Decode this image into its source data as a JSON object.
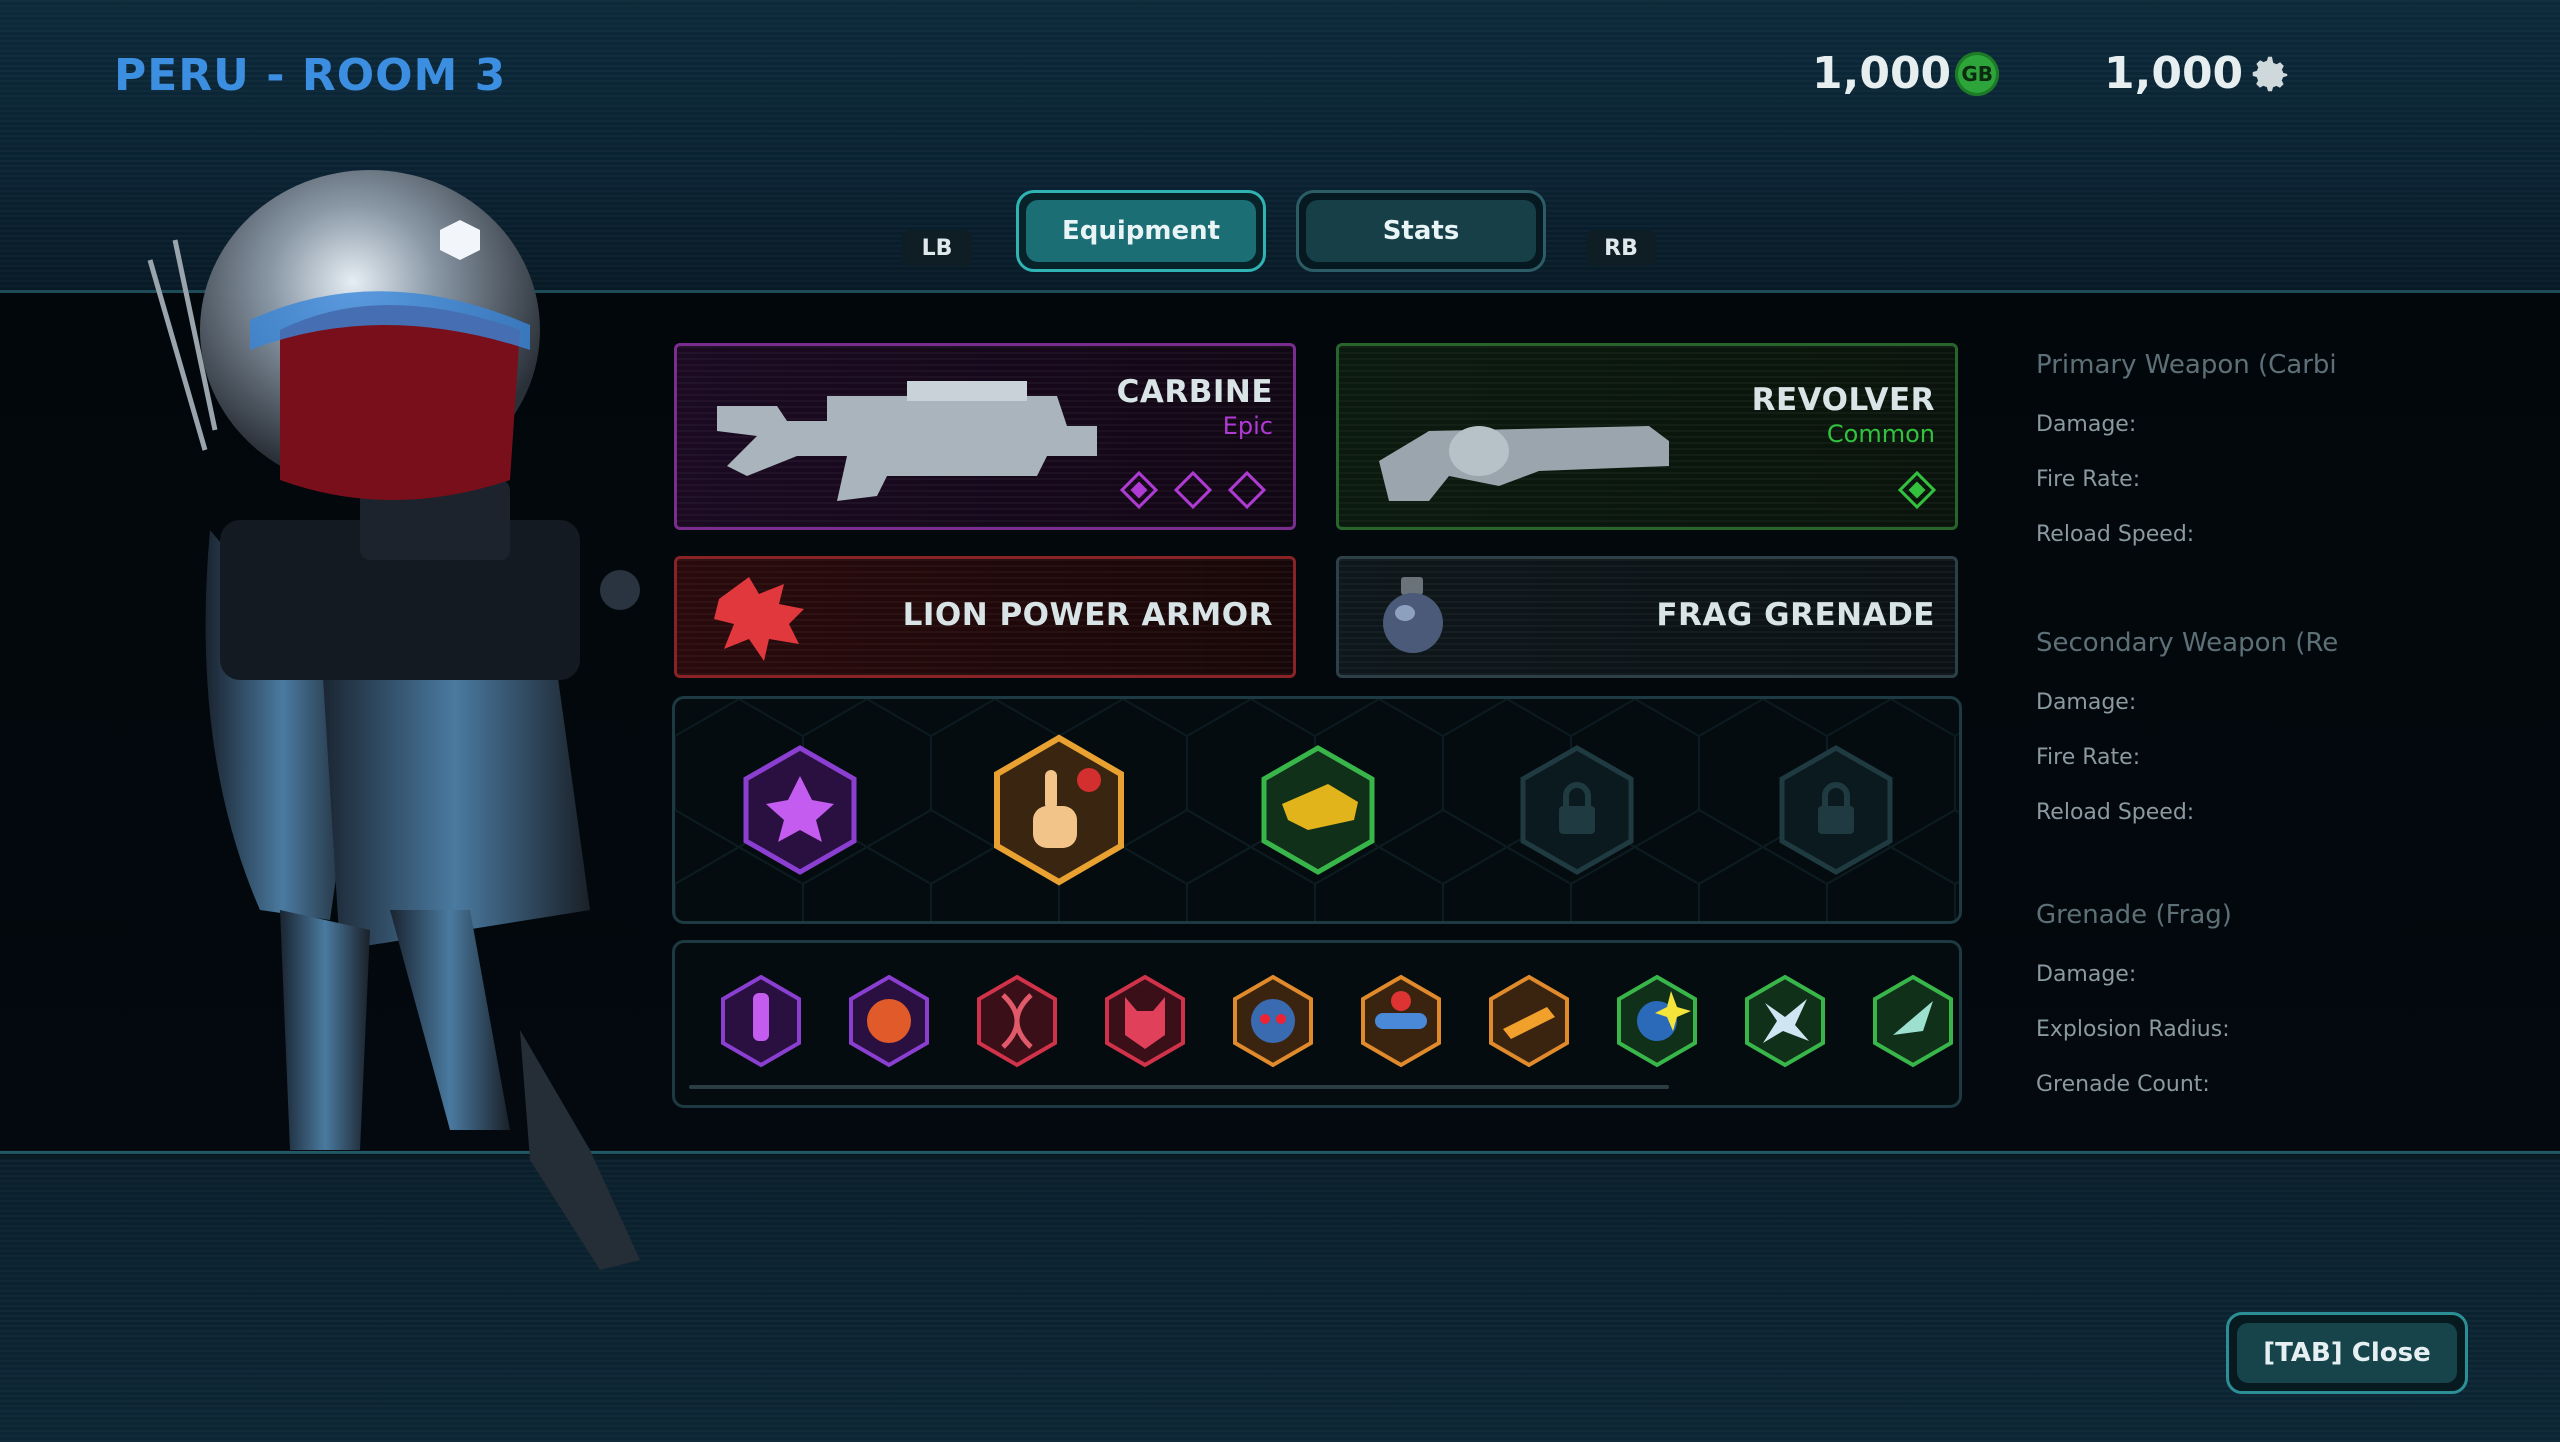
{
  "header": {
    "title": "PERU - ROOM 3",
    "currency_gb": "1,000",
    "currency_gb_icon_label": "GB",
    "currency_gear": "1,000"
  },
  "tabs": {
    "left_bumper": "LB",
    "right_bumper": "RB",
    "items": [
      {
        "label": "Equipment",
        "active": true
      },
      {
        "label": "Stats",
        "active": false
      }
    ]
  },
  "equipment": {
    "primary": {
      "name": "CARBINE",
      "rarity": "Epic",
      "rarity_color": "#b03ad4",
      "slots_filled": 1,
      "slots_total": 3
    },
    "secondary": {
      "name": "REVOLVER",
      "rarity": "Common",
      "rarity_color": "#32c23e",
      "slots_filled": 1,
      "slots_total": 1
    },
    "armor": {
      "name": "LION POWER ARMOR",
      "icon": "lion-head-icon"
    },
    "grenade": {
      "name": "FRAG GRENADE",
      "icon": "grenade-icon"
    }
  },
  "abilities": [
    {
      "icon": "purple-explosion-icon",
      "border": "#8b3fd1",
      "locked": false
    },
    {
      "icon": "pointing-hand-icon",
      "border": "#e9a132",
      "locked": false,
      "selected": true
    },
    {
      "icon": "golden-bird-icon",
      "border": "#39b64a",
      "locked": false
    },
    {
      "icon": "lock-icon",
      "border": "#1f3a40",
      "locked": true
    },
    {
      "icon": "lock-icon",
      "border": "#1f3a40",
      "locked": true
    }
  ],
  "perks": [
    {
      "icon": "vial-icon",
      "border": "#8b3fd1"
    },
    {
      "icon": "angry-face-icon",
      "border": "#8b3fd1"
    },
    {
      "icon": "dna-icon",
      "border": "#d0324a"
    },
    {
      "icon": "demon-icon",
      "border": "#d0324a"
    },
    {
      "icon": "robot-face-icon",
      "border": "#e08a2b"
    },
    {
      "icon": "goggles-icon",
      "border": "#e08a2b"
    },
    {
      "icon": "fire-bullet-icon",
      "border": "#e08a2b"
    },
    {
      "icon": "spark-planet-icon",
      "border": "#39b64a"
    },
    {
      "icon": "shatter-icon",
      "border": "#39b64a"
    },
    {
      "icon": "wing-icon",
      "border": "#39b64a"
    }
  ],
  "stats": {
    "primary_title": "Primary Weapon (Carbi",
    "primary_rows": [
      "Damage:",
      "Fire Rate:",
      "Reload Speed:"
    ],
    "secondary_title": "Secondary Weapon (Re",
    "secondary_rows": [
      "Damage:",
      "Fire Rate:",
      "Reload Speed:"
    ],
    "grenade_title": "Grenade (Frag)",
    "grenade_rows": [
      "Damage:",
      "Explosion Radius:",
      "Grenade Count:"
    ]
  },
  "footer": {
    "close_label": "[TAB] Close"
  }
}
